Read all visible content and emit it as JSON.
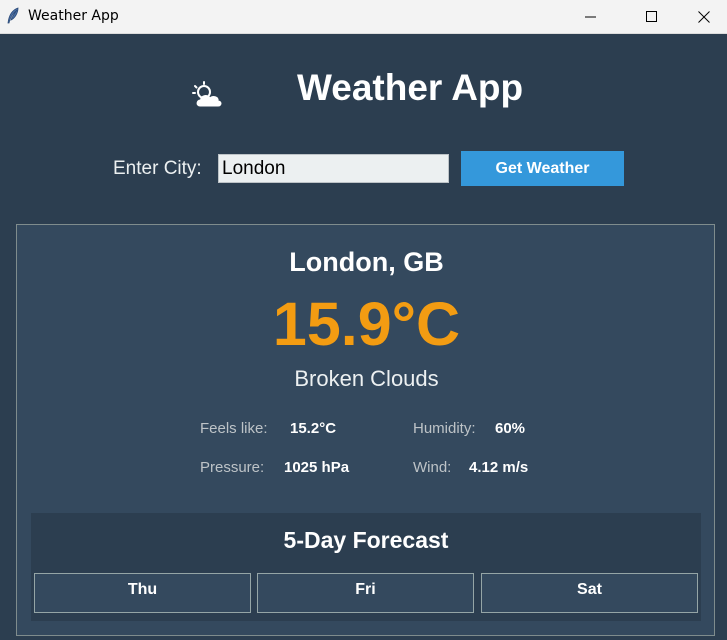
{
  "window": {
    "title": "Weather App"
  },
  "header": {
    "title": "Weather App",
    "icon": "cloud-sun-icon"
  },
  "search": {
    "label": "Enter City:",
    "value": "London",
    "button_label": "Get Weather"
  },
  "current": {
    "location": "London, GB",
    "temperature": "15.9°C",
    "description": "Broken Clouds",
    "feels_like_label": "Feels like:",
    "feels_like_value": "15.2°C",
    "humidity_label": "Humidity:",
    "humidity_value": "60%",
    "pressure_label": "Pressure:",
    "pressure_value": "1025 hPa",
    "wind_label": "Wind:",
    "wind_value": "4.12 m/s"
  },
  "forecast": {
    "title": "5-Day Forecast",
    "days": [
      {
        "day": "Thu",
        "temp": ""
      },
      {
        "day": "Fri",
        "temp": ""
      },
      {
        "day": "Sat",
        "temp": ""
      }
    ]
  },
  "colors": {
    "background": "#2c3e50",
    "card": "#34495e",
    "accent": "#f39c12",
    "button": "#3498db"
  }
}
